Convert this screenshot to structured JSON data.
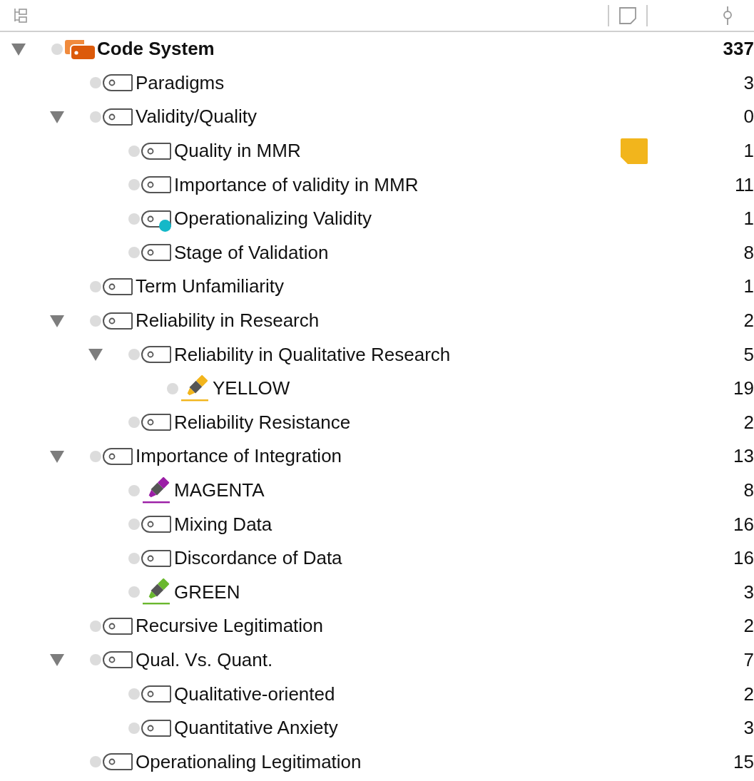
{
  "tree": [
    {
      "kind": "root",
      "label": "Code System",
      "count": "337",
      "expanded": true,
      "children": [
        {
          "kind": "code",
          "label": "Paradigms",
          "count": "3"
        },
        {
          "kind": "code",
          "label": "Validity/Quality",
          "count": "0",
          "expanded": true,
          "children": [
            {
              "kind": "code",
              "label": "Quality in MMR",
              "count": "1",
              "memo": true
            },
            {
              "kind": "code",
              "label": "Importance of validity in MMR",
              "count": "11"
            },
            {
              "kind": "code",
              "label": "Operationalizing Validity",
              "count": "1",
              "color": "#14b8c8"
            },
            {
              "kind": "code",
              "label": "Stage of Validation",
              "count": "8"
            }
          ]
        },
        {
          "kind": "code",
          "label": "Term Unfamiliarity",
          "count": "1"
        },
        {
          "kind": "code",
          "label": "Reliability in Research",
          "count": "2",
          "expanded": true,
          "children": [
            {
              "kind": "code",
              "label": "Reliability in Qualitative Research",
              "count": "5",
              "expanded": true,
              "children": [
                {
                  "kind": "highlighter",
                  "label": "YELLOW",
                  "count": "19",
                  "color": "#f2b51c"
                }
              ]
            },
            {
              "kind": "code",
              "label": "Reliability Resistance",
              "count": "2"
            }
          ]
        },
        {
          "kind": "code",
          "label": "Importance of Integration",
          "count": "13",
          "expanded": true,
          "children": [
            {
              "kind": "highlighter",
              "label": "MAGENTA",
              "count": "8",
              "color": "#9b1ea6"
            },
            {
              "kind": "code",
              "label": "Mixing Data",
              "count": "16"
            },
            {
              "kind": "code",
              "label": "Discordance of Data",
              "count": "16"
            },
            {
              "kind": "highlighter",
              "label": "GREEN",
              "count": "3",
              "color": "#6ab82e"
            }
          ]
        },
        {
          "kind": "code",
          "label": "Recursive Legitimation",
          "count": "2"
        },
        {
          "kind": "code",
          "label": "Qual. Vs. Quant.",
          "count": "7",
          "expanded": true,
          "children": [
            {
              "kind": "code",
              "label": "Qualitative-oriented",
              "count": "2"
            },
            {
              "kind": "code",
              "label": "Quantitative Anxiety",
              "count": "3"
            }
          ]
        },
        {
          "kind": "code",
          "label": "Operationaling Legitimation",
          "count": "15"
        }
      ]
    }
  ]
}
